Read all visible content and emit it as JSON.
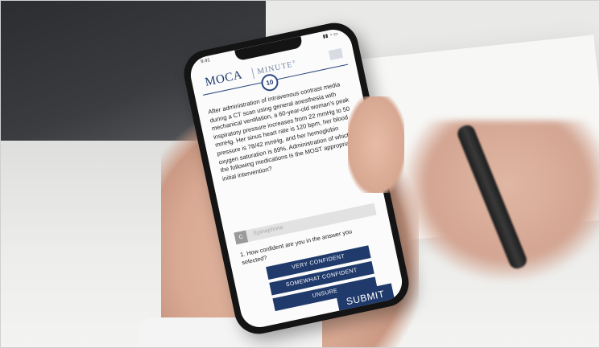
{
  "status": {
    "time": "9:41",
    "icons": "▮▮ ◔ ▭"
  },
  "header": {
    "logo_main": "MOCA",
    "logo_sub": "MINUTE",
    "logo_mark": "®"
  },
  "question": {
    "number": "10",
    "text": "After administration of intravenous contrast media during a CT scan using general anesthesia with mechanical ventilation, a 60-year-old woman's peak inspiratory pressure increases from 22 mmHg to 50 mmHg. Her sinus heart rate is 120 bpm, her blood pressure is 78/42 mmHg, and her hemoglobin oxygen saturation is 89%. Administration of which of the following medications is the MOST appropriate initial intervention?"
  },
  "answer": {
    "letter": "C",
    "text": "Epinephrine"
  },
  "confidence": {
    "prompt": "1. How confident are you in the answer you selected?",
    "options": [
      "VERY CONFIDENT",
      "SOMEWHAT CONFIDENT",
      "UNSURE"
    ]
  },
  "submit_label": "SUBMIT",
  "colors": {
    "brand_navy": "#203a6b",
    "logo_blue": "#1f3a6f"
  }
}
